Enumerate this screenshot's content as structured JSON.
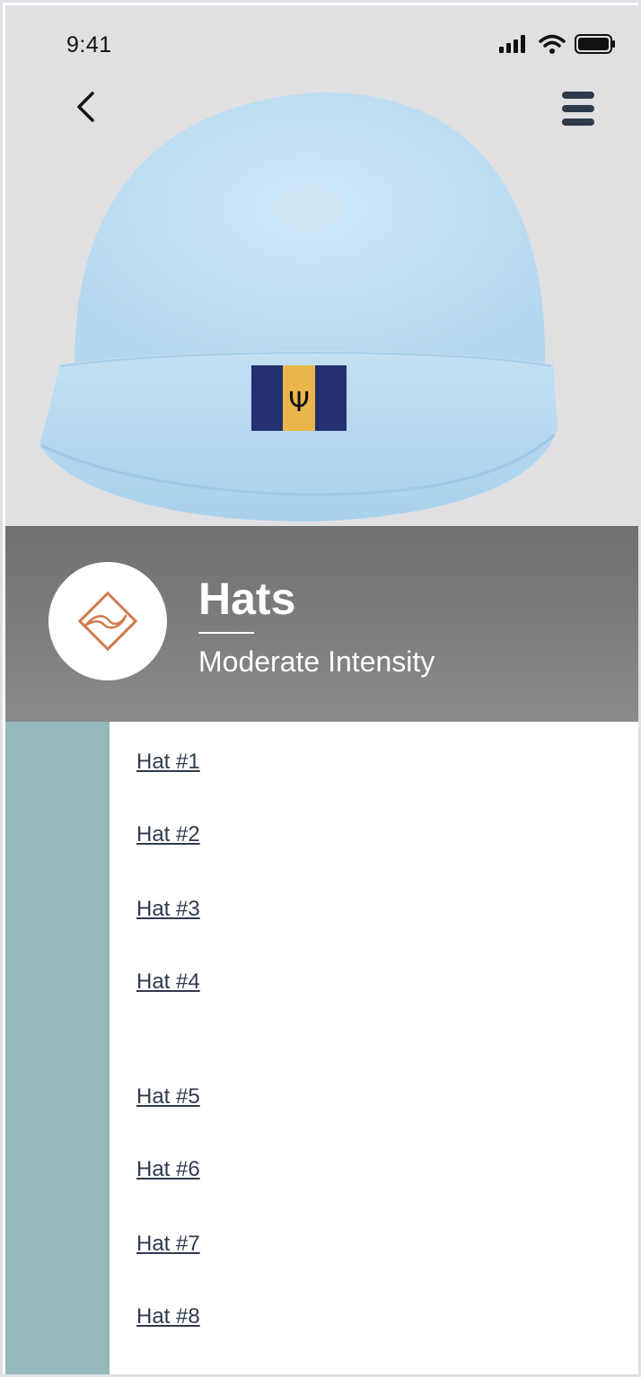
{
  "status_bar": {
    "time": "9:41",
    "icons": [
      "signal-icon",
      "wifi-icon",
      "battery-icon"
    ]
  },
  "nav": {
    "back_icon": "chevron-left-icon",
    "menu_icon": "hamburger-menu-icon"
  },
  "hero": {
    "image": "light blue knit hat with Barbados flag patch"
  },
  "category": {
    "badge_icon": "wave-diamond-icon",
    "title": "Hats",
    "subtitle": "Moderate Intensity"
  },
  "items": [
    {
      "label": "Hat #1"
    },
    {
      "label": "Hat #2"
    },
    {
      "label": "Hat #3"
    },
    {
      "label": "Hat #4"
    },
    {
      "label": "Hat #5"
    },
    {
      "label": "Hat #6"
    },
    {
      "label": "Hat #7"
    },
    {
      "label": "Hat #8"
    }
  ],
  "colors": {
    "accent_rail": "#93b9bb",
    "badge_icon": "#cf7a4f",
    "link_text": "#2e3b4e",
    "band": "#7a7a7a"
  }
}
